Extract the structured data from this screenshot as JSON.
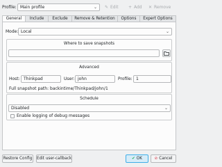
{
  "toolbar": {
    "profile_label": "Profile:",
    "profile_value": "Main profile",
    "edit_label": "Edit",
    "add_label": "Add",
    "remove_label": "Remove"
  },
  "tabs": [
    {
      "label": "General",
      "active": true
    },
    {
      "label": "Include",
      "active": false
    },
    {
      "label": "Exclude",
      "active": false
    },
    {
      "label": "Remove & Retention",
      "active": false
    },
    {
      "label": "Options",
      "active": false
    },
    {
      "label": "Expert Options",
      "active": false
    }
  ],
  "general": {
    "mode_label": "Mode:",
    "mode_value": "Local",
    "snapshots_group": {
      "title": "Where to save snapshots",
      "path_value": ""
    },
    "advanced_group": {
      "title": "Advanced",
      "host_label": "Host:",
      "host_value": "Thinkpad",
      "user_label": "User:",
      "user_value": "john",
      "profile_label": "Profile:",
      "profile_value": "1",
      "full_path_text": "Full snapshot path: backintime/Thinkpad/john/1"
    },
    "schedule_group": {
      "title": "Schedule",
      "schedule_value": "Disabled",
      "debug_log_label": "Enable logging of debug messages",
      "debug_log_checked": false
    }
  },
  "footer": {
    "restore_config_label": "Restore Config",
    "edit_callback_label": "Edit user-callback",
    "ok_label": "OK",
    "cancel_label": "Cancel"
  },
  "icons": {
    "edit": "pencil-icon",
    "add": "plus-icon",
    "remove": "close-icon",
    "folder": "folder-icon",
    "ok": "check-circle-icon",
    "cancel": "cancel-circle-icon"
  },
  "colors": {
    "window_bg": "#eff0f1",
    "panel_bg": "#fcfcfc",
    "accent": "#3daee9",
    "ok_icon": "#27ae60",
    "cancel_icon": "#da4453"
  }
}
